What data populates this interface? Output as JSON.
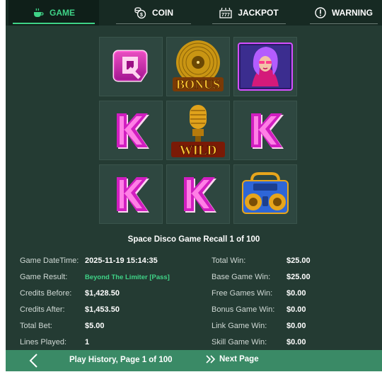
{
  "tabs": [
    {
      "label": "GAME",
      "icon": "coffee-cup-icon",
      "active": true
    },
    {
      "label": "COIN",
      "icon": "coin-stack-icon",
      "active": false
    },
    {
      "label": "JACKPOT",
      "icon": "jackpot-777-icon",
      "active": false
    },
    {
      "label": "WARNING",
      "icon": "warning-icon",
      "active": false
    }
  ],
  "reels": {
    "symbols": [
      [
        "q-symbol",
        "bonus-vinyl-symbol",
        "disco-girl-symbol"
      ],
      [
        "k-symbol",
        "wild-microphone-symbol",
        "k-symbol"
      ],
      [
        "k-symbol",
        "k-symbol",
        "boombox-symbol"
      ]
    ],
    "bonus_text": "BONUS",
    "wild_text": "WILD",
    "q_text": "Q",
    "k_text": "K"
  },
  "recall": {
    "title": "Space Disco Game Recall 1 of 100"
  },
  "details": {
    "left": [
      {
        "label": "Game DateTime:",
        "value": "2025-11-19 15:14:35"
      },
      {
        "label": "Game Result:",
        "value": "Beyond The Limiter [Pass]"
      },
      {
        "label": "Credits Before:",
        "value": "$1,428.50"
      },
      {
        "label": "Credits After:",
        "value": "$1,453.50"
      },
      {
        "label": "Total Bet:",
        "value": "$5.00"
      },
      {
        "label": "Lines Played:",
        "value": "1"
      }
    ],
    "right": [
      {
        "label": "Total Win:",
        "value": "$25.00"
      },
      {
        "label": "Base Game Win:",
        "value": "$25.00"
      },
      {
        "label": "Free Games Win:",
        "value": "$0.00"
      },
      {
        "label": "Bonus Game Win:",
        "value": "$0.00"
      },
      {
        "label": "Link Game Win:",
        "value": "$0.00"
      },
      {
        "label": "Skill Game Win:",
        "value": "$0.00"
      }
    ]
  },
  "footer": {
    "page_text": "Play History, Page 1 of 100",
    "next_label": "Next Page"
  },
  "colors": {
    "background": "#243b33",
    "accent": "#3fd387",
    "footer": "#3a8a66"
  }
}
